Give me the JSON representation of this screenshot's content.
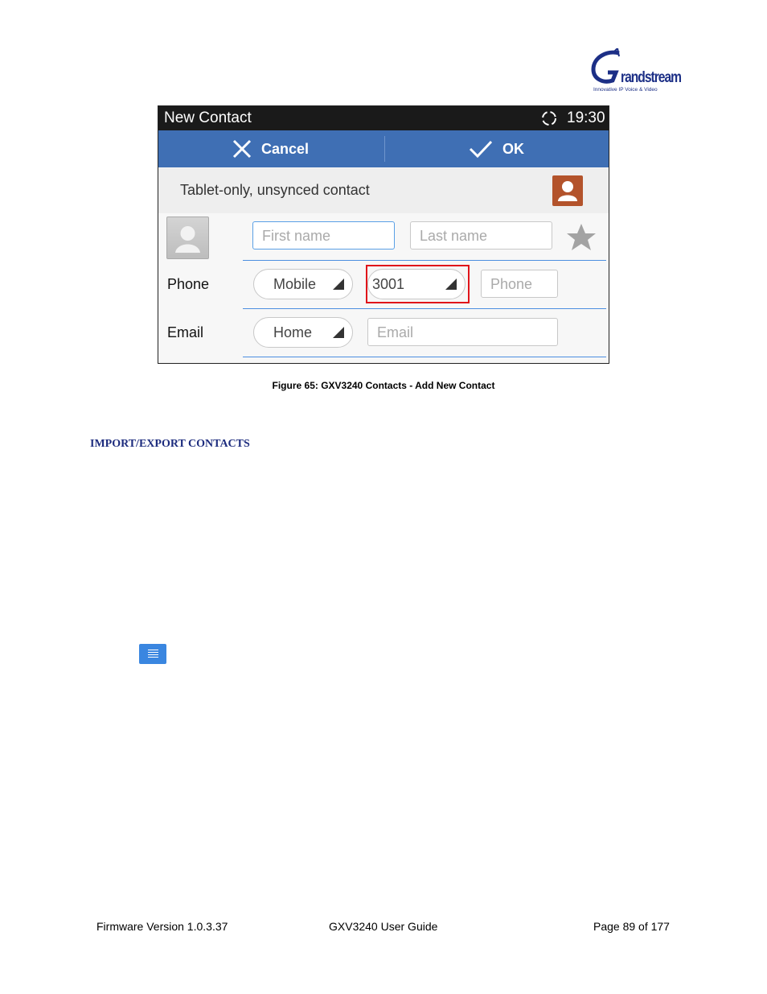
{
  "logo": {
    "wordmark": "randstream",
    "initial": "G",
    "tagline": "Innovative IP Voice & Video"
  },
  "figure": {
    "statusbar": {
      "title": "New Contact",
      "time": "19:30"
    },
    "actionbar": {
      "cancel_label": "Cancel",
      "ok_label": "OK"
    },
    "account": {
      "label": "Tablet-only, unsynced contact"
    },
    "name": {
      "first_placeholder": "First name",
      "last_placeholder": "Last name"
    },
    "phone": {
      "label": "Phone",
      "type": "Mobile",
      "line": "3001",
      "placeholder": "Phone"
    },
    "email": {
      "label": "Email",
      "type": "Home",
      "placeholder": "Email"
    },
    "colors": {
      "action_bar": "#3f6fb4",
      "highlight": "#e0141a",
      "divider": "#4d8fe0"
    }
  },
  "caption": "Figure 65: GXV3240 Contacts - Add New Contact",
  "section_heading": "IMPORT/EXPORT CONTACTS",
  "menu_icon": "menu-list-icon",
  "footer": {
    "left": "Firmware Version 1.0.3.37",
    "center": "GXV3240 User Guide",
    "right": "Page 89 of 177"
  }
}
